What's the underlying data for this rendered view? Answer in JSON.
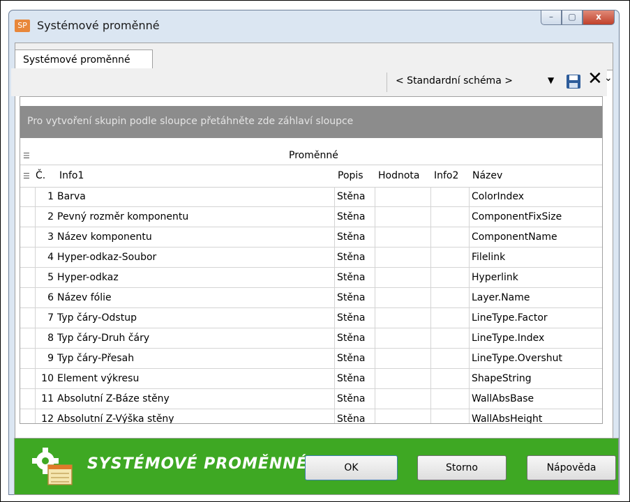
{
  "window": {
    "icon_text": "SP",
    "title": "Systémové proměnné",
    "controls": [
      "–",
      "▢",
      "x"
    ]
  },
  "tab": {
    "label": "Systémové proměnné"
  },
  "toolbar": {
    "schema_value": "< Standardní schéma >",
    "close_glyph": "✕",
    "more_glyph": "⌄"
  },
  "grid": {
    "group_hint": "Pro vytvoření skupin podle sloupce přetáhněte zde záhlaví sloupce",
    "band_label": "Proměnné",
    "columns": {
      "no": "Č.",
      "info1": "Info1",
      "popis": "Popis",
      "hodnota": "Hodnota",
      "info2": "Info2",
      "nazev": "Název"
    },
    "rows": [
      {
        "no": "1",
        "info1": "Barva",
        "popis": "Stěna",
        "hodnota": "",
        "info2": "",
        "nazev": "ColorIndex"
      },
      {
        "no": "2",
        "info1": "Pevný rozměr komponentu",
        "popis": "Stěna",
        "hodnota": "",
        "info2": "",
        "nazev": "ComponentFixSize"
      },
      {
        "no": "3",
        "info1": "Název komponentu",
        "popis": "Stěna",
        "hodnota": "",
        "info2": "",
        "nazev": "ComponentName"
      },
      {
        "no": "4",
        "info1": "Hyper-odkaz-Soubor",
        "popis": "Stěna",
        "hodnota": "",
        "info2": "",
        "nazev": "Filelink"
      },
      {
        "no": "5",
        "info1": "Hyper-odkaz",
        "popis": "Stěna",
        "hodnota": "",
        "info2": "",
        "nazev": "Hyperlink"
      },
      {
        "no": "6",
        "info1": "Název fólie",
        "popis": "Stěna",
        "hodnota": "",
        "info2": "",
        "nazev": "Layer.Name"
      },
      {
        "no": "7",
        "info1": "Typ čáry-Odstup",
        "popis": "Stěna",
        "hodnota": "",
        "info2": "",
        "nazev": "LineType.Factor"
      },
      {
        "no": "8",
        "info1": "Typ čáry-Druh čáry",
        "popis": "Stěna",
        "hodnota": "",
        "info2": "",
        "nazev": "LineType.Index"
      },
      {
        "no": "9",
        "info1": "Typ čáry-Přesah",
        "popis": "Stěna",
        "hodnota": "",
        "info2": "",
        "nazev": "LineType.Overshut"
      },
      {
        "no": "10",
        "info1": "Element výkresu",
        "popis": "Stěna",
        "hodnota": "",
        "info2": "",
        "nazev": "ShapeString"
      },
      {
        "no": "11",
        "info1": "Absolutní Z-Báze stěny",
        "popis": "Stěna",
        "hodnota": "",
        "info2": "",
        "nazev": "WallAbsBase"
      },
      {
        "no": "12",
        "info1": "Absolutní Z-Výška stěny",
        "popis": "Stěna",
        "hodnota": "",
        "info2": "",
        "nazev": "WallAbsHeight"
      }
    ]
  },
  "footer": {
    "title": "SYSTÉMOVÉ PROMĚNNÉ",
    "ok_label": "OK",
    "cancel_label": "Storno",
    "help_label": "Nápověda"
  },
  "colors": {
    "footer_bg": "#3ea823",
    "group_bar_bg": "#8c8c8c",
    "window_frame": "#dbe6f2"
  }
}
